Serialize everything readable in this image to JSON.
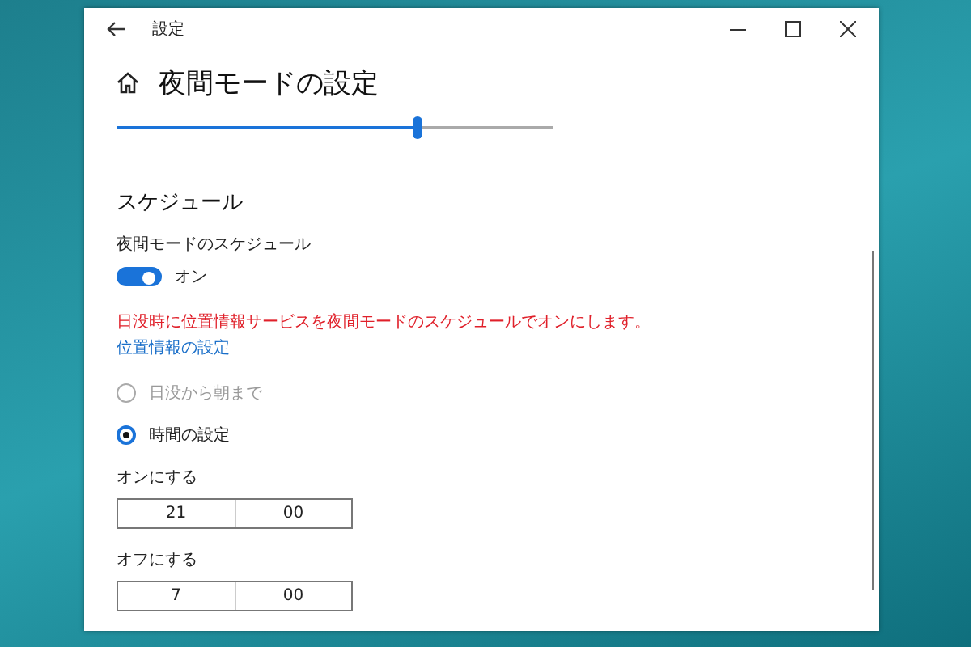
{
  "window": {
    "title": "設定"
  },
  "page": {
    "title": "夜間モードの設定"
  },
  "strength_slider": {
    "level": 0.69
  },
  "schedule": {
    "heading": "スケジュール",
    "toggle_label": "夜間モードのスケジュール",
    "toggle": {
      "on": true,
      "state_text": "オン"
    },
    "warning": "日没時に位置情報サービスを夜間モードのスケジュールでオンにします。",
    "link": "位置情報の設定",
    "options": [
      {
        "label": "日没から朝まで",
        "selected": false,
        "disabled": true
      },
      {
        "label": "時間の設定",
        "selected": true,
        "disabled": false
      }
    ],
    "times": [
      {
        "label": "オンにする",
        "hour": "21",
        "minute": "00"
      },
      {
        "label": "オフにする",
        "hour": "7",
        "minute": "00"
      }
    ]
  }
}
